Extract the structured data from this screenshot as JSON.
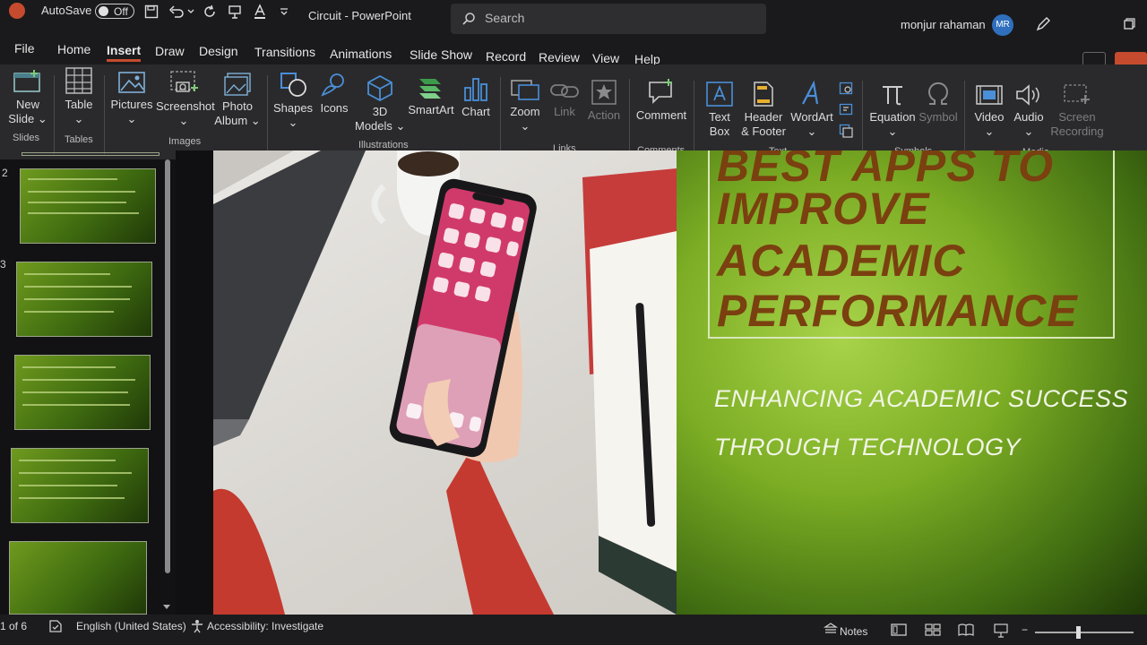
{
  "titlebar": {
    "autosave_label": "AutoSave",
    "autosave_state": "Off",
    "doc_title": "Circuit - PowerPoint",
    "search_placeholder": "Search",
    "user_name": "monjur rahaman",
    "user_initials": "MR"
  },
  "menu": {
    "tabs": [
      "File",
      "Home",
      "Insert",
      "Draw",
      "Design",
      "Transitions",
      "Animations",
      "Slide Show",
      "Record",
      "Review",
      "View",
      "Help"
    ],
    "active": "Insert"
  },
  "ribbon": {
    "new_slide": [
      "New",
      "Slide"
    ],
    "table": "Table",
    "pictures": "Pictures",
    "screenshot": "Screenshot",
    "photo_album": [
      "Photo",
      "Album"
    ],
    "shapes": "Shapes",
    "icons": "Icons",
    "models_3d": [
      "3D",
      "Models"
    ],
    "smartart": "SmartArt",
    "chart": "Chart",
    "zoom": "Zoom",
    "link": "Link",
    "action": "Action",
    "comment": "Comment",
    "text_box": [
      "Text",
      "Box"
    ],
    "header_footer": [
      "Header",
      "& Footer"
    ],
    "wordart": "WordArt",
    "equation": "Equation",
    "symbol": "Symbol",
    "video": "Video",
    "audio": "Audio",
    "screen_recording": [
      "Screen",
      "Recording"
    ],
    "groups": {
      "slides": "Slides",
      "tables": "Tables",
      "images": "Images",
      "illustrations": "Illustrations",
      "links": "Links",
      "comments": "Comments",
      "text": "Text",
      "symbols": "Symbols",
      "media": "Media"
    }
  },
  "thumbnails": {
    "numbers": [
      "2",
      "3"
    ]
  },
  "slide": {
    "title_lines": [
      "BEST APPS TO",
      "IMPROVE",
      "ACADEMIC",
      "PERFORMANCE"
    ],
    "subtitle_lines": [
      "ENHANCING ACADEMIC SUCCESS",
      "THROUGH TECHNOLOGY"
    ]
  },
  "status": {
    "slide_counter": "1 of 6",
    "language": "English (United States)",
    "accessibility": "Accessibility: Investigate",
    "notes": "Notes"
  },
  "colors": {
    "accent": "#c64b2e",
    "title_text": "#7a4010",
    "slide_green": "#7cad24"
  }
}
